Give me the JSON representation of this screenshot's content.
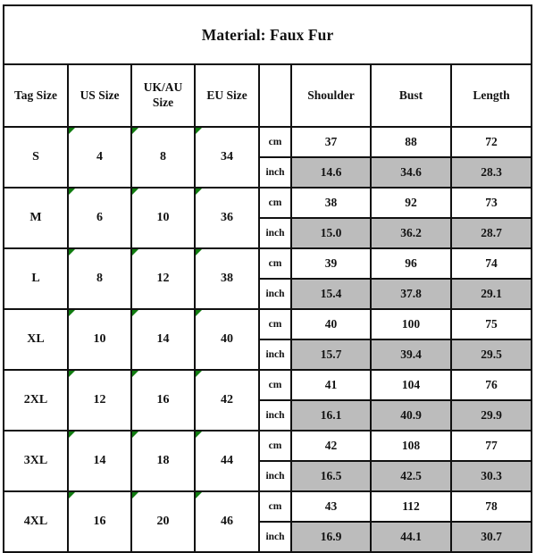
{
  "title": "Material: Faux Fur",
  "headers": {
    "tag_size": "Tag Size",
    "us_size": "US Size",
    "uk_au_size": "UK/AU Size",
    "eu_size": "EU Size",
    "unit": "",
    "shoulder": "Shoulder",
    "bust": "Bust",
    "length": "Length"
  },
  "units": {
    "cm": "cm",
    "inch": "inch"
  },
  "colors": {
    "inch_row_background": "#bcbcbc",
    "border": "#111111",
    "marker": "#107c10",
    "text": "#121212",
    "page_background": "#ffffff"
  },
  "rows": [
    {
      "tag_size": "S",
      "us_size": "4",
      "uk_au_size": "8",
      "eu_size": "34",
      "cm": {
        "shoulder": "37",
        "bust": "88",
        "length": "72"
      },
      "inch": {
        "shoulder": "14.6",
        "bust": "34.6",
        "length": "28.3"
      }
    },
    {
      "tag_size": "M",
      "us_size": "6",
      "uk_au_size": "10",
      "eu_size": "36",
      "cm": {
        "shoulder": "38",
        "bust": "92",
        "length": "73"
      },
      "inch": {
        "shoulder": "15.0",
        "bust": "36.2",
        "length": "28.7"
      }
    },
    {
      "tag_size": "L",
      "us_size": "8",
      "uk_au_size": "12",
      "eu_size": "38",
      "cm": {
        "shoulder": "39",
        "bust": "96",
        "length": "74"
      },
      "inch": {
        "shoulder": "15.4",
        "bust": "37.8",
        "length": "29.1"
      }
    },
    {
      "tag_size": "XL",
      "us_size": "10",
      "uk_au_size": "14",
      "eu_size": "40",
      "cm": {
        "shoulder": "40",
        "bust": "100",
        "length": "75"
      },
      "inch": {
        "shoulder": "15.7",
        "bust": "39.4",
        "length": "29.5"
      }
    },
    {
      "tag_size": "2XL",
      "us_size": "12",
      "uk_au_size": "16",
      "eu_size": "42",
      "cm": {
        "shoulder": "41",
        "bust": "104",
        "length": "76"
      },
      "inch": {
        "shoulder": "16.1",
        "bust": "40.9",
        "length": "29.9"
      }
    },
    {
      "tag_size": "3XL",
      "us_size": "14",
      "uk_au_size": "18",
      "eu_size": "44",
      "cm": {
        "shoulder": "42",
        "bust": "108",
        "length": "77"
      },
      "inch": {
        "shoulder": "16.5",
        "bust": "42.5",
        "length": "30.3"
      }
    },
    {
      "tag_size": "4XL",
      "us_size": "16",
      "uk_au_size": "20",
      "eu_size": "46",
      "cm": {
        "shoulder": "43",
        "bust": "112",
        "length": "78"
      },
      "inch": {
        "shoulder": "16.9",
        "bust": "44.1",
        "length": "30.7"
      }
    }
  ]
}
